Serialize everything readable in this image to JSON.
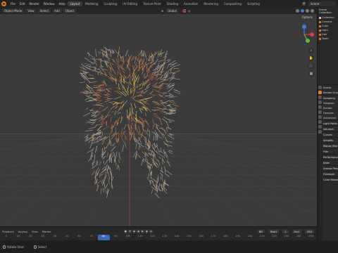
{
  "topbar": {
    "menus": [
      "File",
      "Edit",
      "Render",
      "Window",
      "Help"
    ],
    "workspaces": [
      "Layout",
      "Modeling",
      "Sculpting",
      "UV Editing",
      "Texture Paint",
      "Shading",
      "Animation",
      "Rendering",
      "Compositing",
      "Scripting"
    ],
    "active_workspace": "Layout",
    "scene_label": "Scene"
  },
  "header": {
    "mode": "Object Mode",
    "view_menu": "View",
    "select_menu": "Select",
    "add_menu": "Add",
    "object_menu": "Object",
    "transform_orientation": "Global",
    "options_label": "Options"
  },
  "viewport": {
    "grid_color": "#474747",
    "axis_x_color": "#b5424b",
    "background": "#3b3b3b"
  },
  "navigation_gizmo": {
    "x_color": "#d9404a",
    "y_color": "#6fb33a",
    "z_color": "#3f7de0"
  },
  "outliner": {
    "title": "Scene Collection",
    "rows": [
      {
        "label": "Collection",
        "color": "#d0d0d0"
      },
      {
        "label": "Camera",
        "color": "#d9822b"
      },
      {
        "label": "Cube",
        "color": "#d9822b"
      },
      {
        "label": "Light",
        "color": "#d9822b"
      },
      {
        "label": "Hair",
        "color": "#d9822b"
      },
      {
        "label": "Tooth",
        "color": "#d9822b"
      }
    ]
  },
  "properties": {
    "rows": [
      {
        "label": "Scene",
        "section": true
      },
      {
        "label": "Render Engine",
        "section": false
      },
      {
        "label": "Sampling",
        "section": true
      },
      {
        "label": "Viewport",
        "section": false
      },
      {
        "label": "Render",
        "section": false
      },
      {
        "label": "Denoise",
        "section": false
      },
      {
        "label": "Advanced",
        "section": false
      },
      {
        "label": "Light Paths",
        "section": true
      },
      {
        "label": "Volumes",
        "section": true
      },
      {
        "label": "Curves",
        "section": true
      },
      {
        "label": "Simplify",
        "section": true
      },
      {
        "label": "Motion Blur",
        "section": true
      },
      {
        "label": "Film",
        "section": true
      },
      {
        "label": "Performance",
        "section": true
      },
      {
        "label": "Bake",
        "section": true
      },
      {
        "label": "Grease Pencil",
        "section": true
      },
      {
        "label": "Freestyle",
        "section": true
      },
      {
        "label": "Color Management",
        "section": true
      }
    ]
  },
  "timeline": {
    "menus": [
      "Playback",
      "Keying",
      "View",
      "Marker"
    ],
    "current_frame": "80",
    "start_label": "Start",
    "start_value": "1",
    "end_label": "End",
    "end_value": "250",
    "ticks": [
      "0",
      "10",
      "20",
      "30",
      "40",
      "50",
      "60",
      "70",
      "80",
      "90",
      "100",
      "110",
      "120",
      "130",
      "140",
      "150",
      "160",
      "170",
      "180",
      "190",
      "200",
      "210",
      "220",
      "230",
      "240",
      "250"
    ],
    "current_tick_index": 8
  },
  "statusbar": {
    "left": "Rotate View",
    "right": "Select"
  }
}
